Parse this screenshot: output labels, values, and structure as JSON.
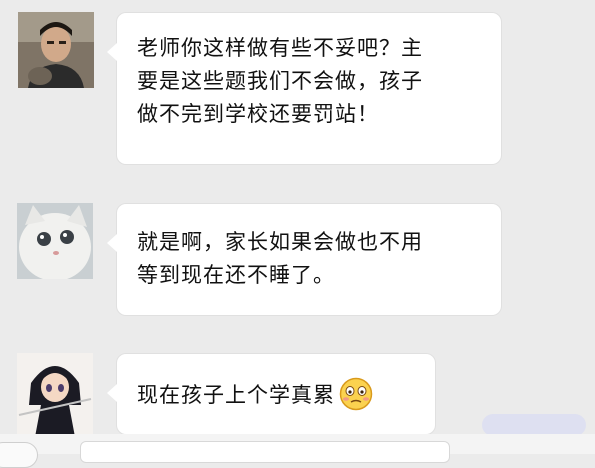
{
  "messages": [
    {
      "avatar": "young-man-avatar",
      "lines": [
        "老师你这样做有些不妥吧？主",
        "要是这些题我们不会做，孩子",
        "做不完到学校还要罚站！"
      ]
    },
    {
      "avatar": "white-cat-avatar",
      "lines": [
        "就是啊，家长如果会做也不用",
        "等到现在还不睡了。"
      ]
    },
    {
      "avatar": "anime-character-avatar",
      "lines": [
        "现在孩子上个学真累"
      ],
      "emoji": "awkward-face-emoji"
    }
  ],
  "colors": {
    "background": "#ebebeb",
    "bubble": "#ffffff",
    "text": "#111111"
  }
}
